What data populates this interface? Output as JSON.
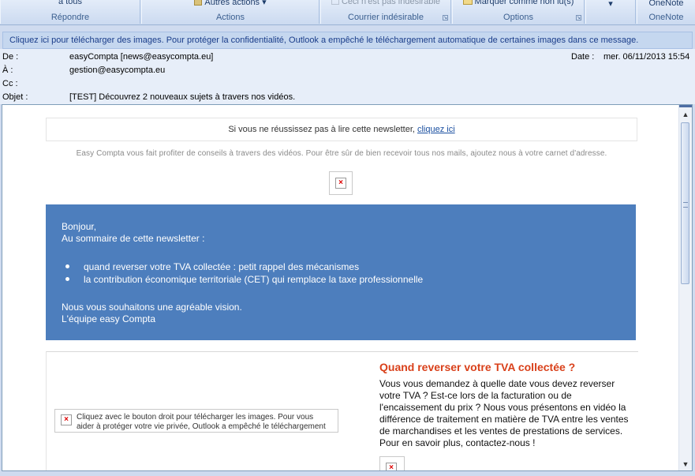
{
  "ribbon": {
    "groups": [
      {
        "top": "à tous",
        "label": "Répondre"
      },
      {
        "top": "Autres actions",
        "label": "Actions"
      },
      {
        "top": "Ceci n'est pas indésirable",
        "label": "Courrier indésirable"
      },
      {
        "top": "Marquer comme non lu(s)",
        "label": "Options"
      },
      {
        "top": "",
        "label": ""
      },
      {
        "top": "OneNote",
        "label": "OneNote"
      }
    ]
  },
  "infobar": {
    "text": "Cliquez ici pour télécharger des images. Pour protéger la confidentialité, Outlook a empêché le téléchargement automatique de certaines images dans ce message."
  },
  "header": {
    "from_label": "De :",
    "from": "easyCompta [news@easycompta.eu]",
    "to_label": "À :",
    "to": "gestion@easycompta.eu",
    "cc_label": "Cc :",
    "cc": "",
    "subject_label": "Objet :",
    "subject": "[TEST] Découvrez 2 nouveaux sujets à travers nos vidéos.",
    "date_label": "Date :",
    "date": "mer. 06/11/2013 15:54"
  },
  "message": {
    "topnote_text": "Si vous ne réussissez pas à lire cette newsletter, ",
    "topnote_link": "cliquez ici",
    "subline": "Easy Compta vous fait profiter de conseils à travers des vidéos. Pour être sûr de bien recevoir tous nos mails, ajoutez nous à votre carnet d'adresse.",
    "intro": {
      "greeting": "Bonjour,",
      "summary": "Au sommaire de cette newsletter :",
      "items": [
        "quand reverser votre TVA collectée : petit rappel des mécanismes",
        "la contribution économique territoriale (CET) qui remplace la taxe professionnelle"
      ],
      "closing": "Nous vous souhaitons une agréable vision.",
      "signature": "L'équipe easy Compta"
    },
    "article": {
      "image_text": "Cliquez avec le bouton droit pour télécharger les images. Pour vous aider à protéger votre vie privée, Outlook a empêché le téléchargement",
      "title": "Quand reverser votre TVA collectée ?",
      "body": "Vous vous demandez à quelle date vous devez reverser votre TVA ? Est-ce lors de la facturation ou de l'encaissement du prix ? Nous vous présentons en vidéo la différence de traitement en matière de TVA entre les ventes de marchandises et les ventes de prestations de services. Pour en savoir plus, contactez-nous !"
    },
    "broken_icon": "broken-image-icon"
  },
  "colors": {
    "ribbon": "#cbdaf0",
    "banner_blue": "#4d7ebd",
    "title_orange": "#d9401a",
    "infobar_text": "#1a3d8a"
  }
}
